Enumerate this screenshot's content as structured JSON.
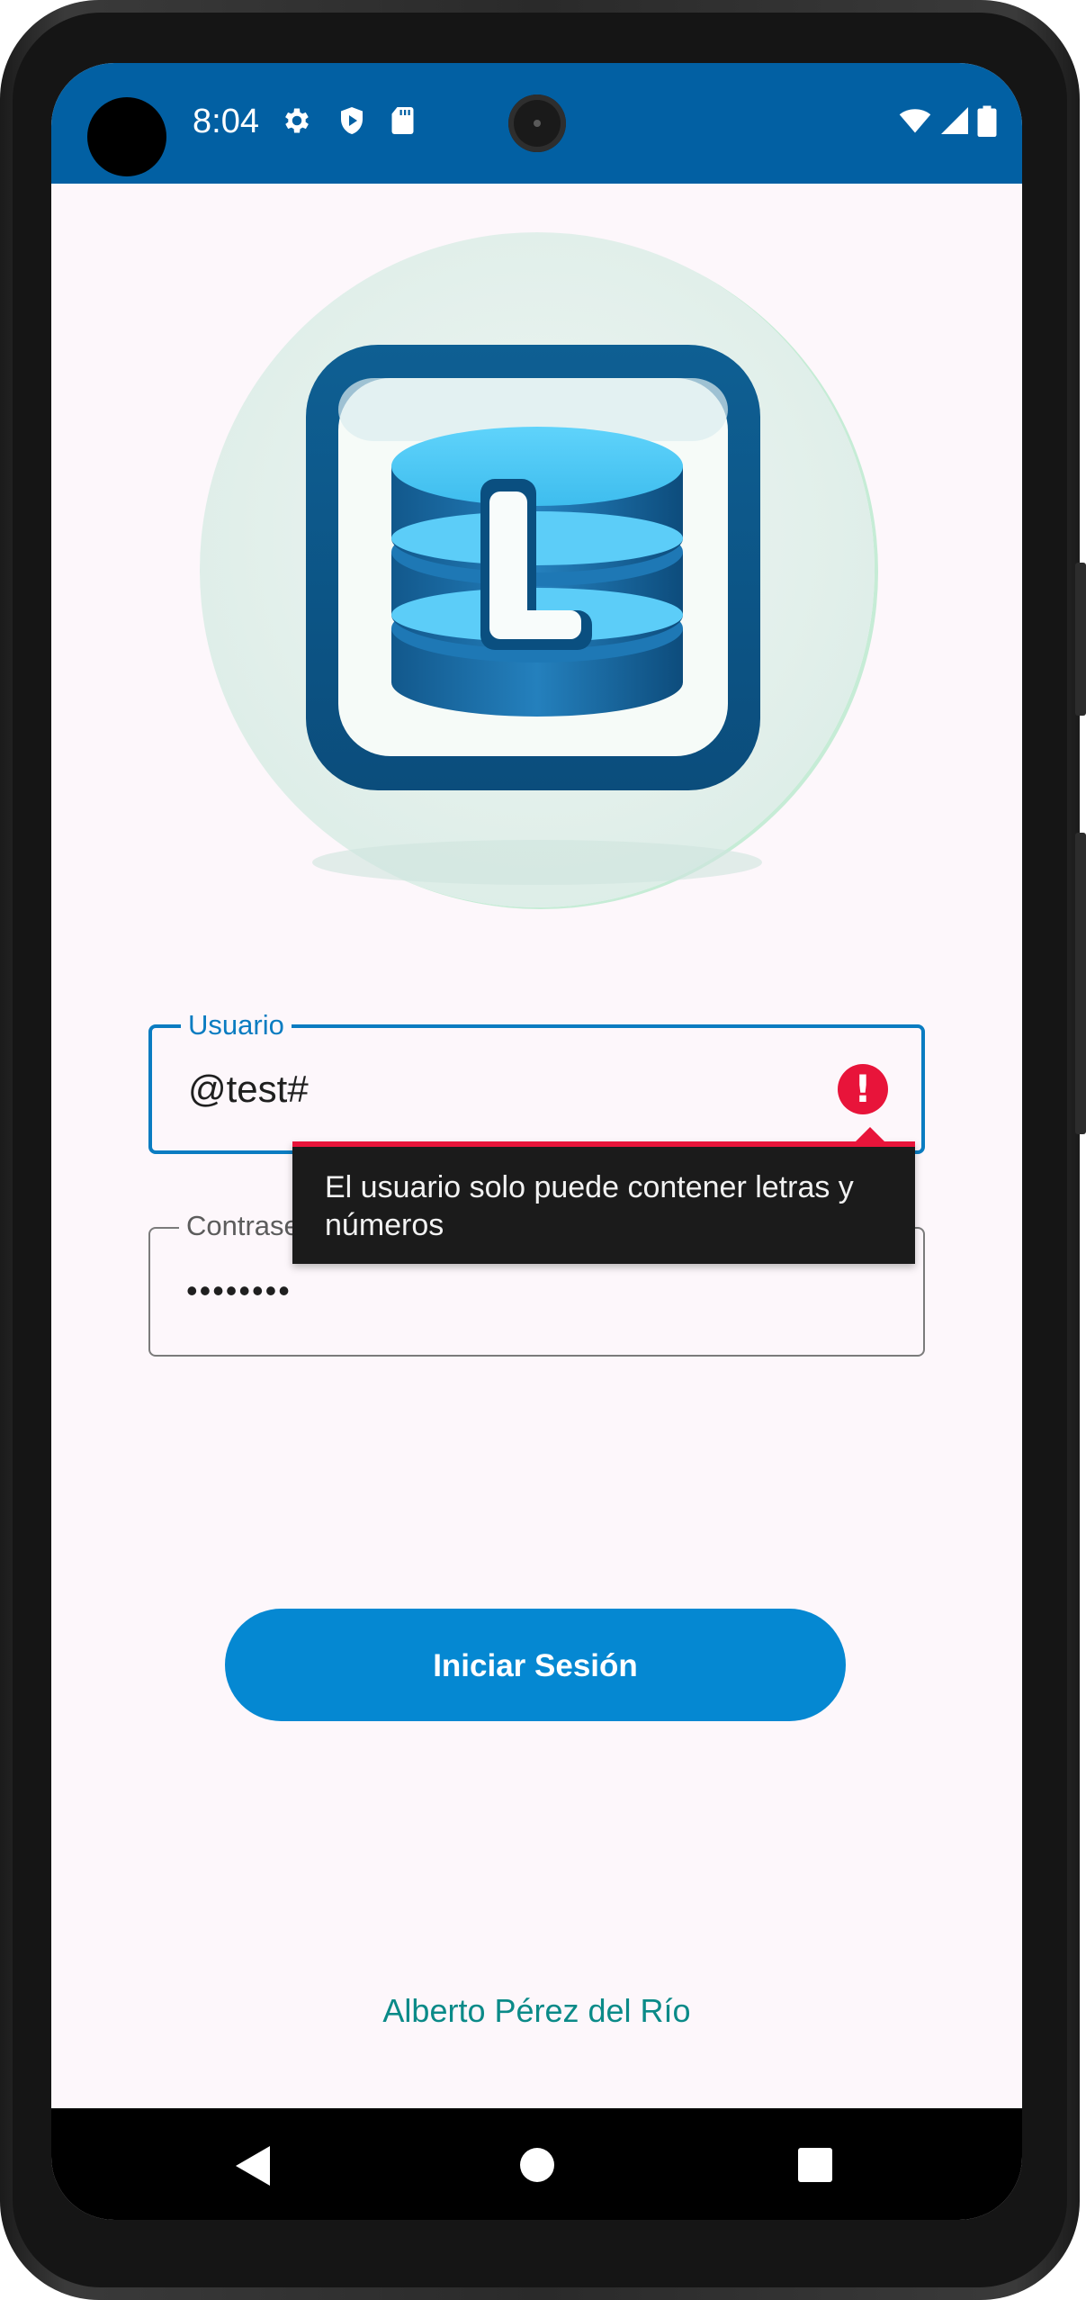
{
  "status_bar": {
    "time": "8:04",
    "left_icons": [
      "gear-icon",
      "shield-icon",
      "sd-card-icon"
    ],
    "right_icons": [
      "wifi-icon",
      "signal-icon",
      "battery-icon"
    ]
  },
  "logo": {
    "letter": "L",
    "icon": "database-logo-icon"
  },
  "form": {
    "username": {
      "label": "Usuario",
      "value": "@test#",
      "state": "error"
    },
    "password": {
      "label": "Contraseña",
      "value": "••••••••"
    },
    "error_message": "El usuario solo puede contener letras y números"
  },
  "login_button": {
    "label": "Iniciar Sesión"
  },
  "footer": {
    "author": "Alberto Pérez del Río"
  },
  "nav": {
    "icons": [
      "back-icon",
      "home-icon",
      "recents-icon"
    ]
  },
  "colors": {
    "status_bar": "#0260a3",
    "primary": "#0588d2",
    "focus": "#0a7cc1",
    "error": "#e8143a",
    "author_text": "#0a8a88",
    "background": "#fdf7fb"
  }
}
